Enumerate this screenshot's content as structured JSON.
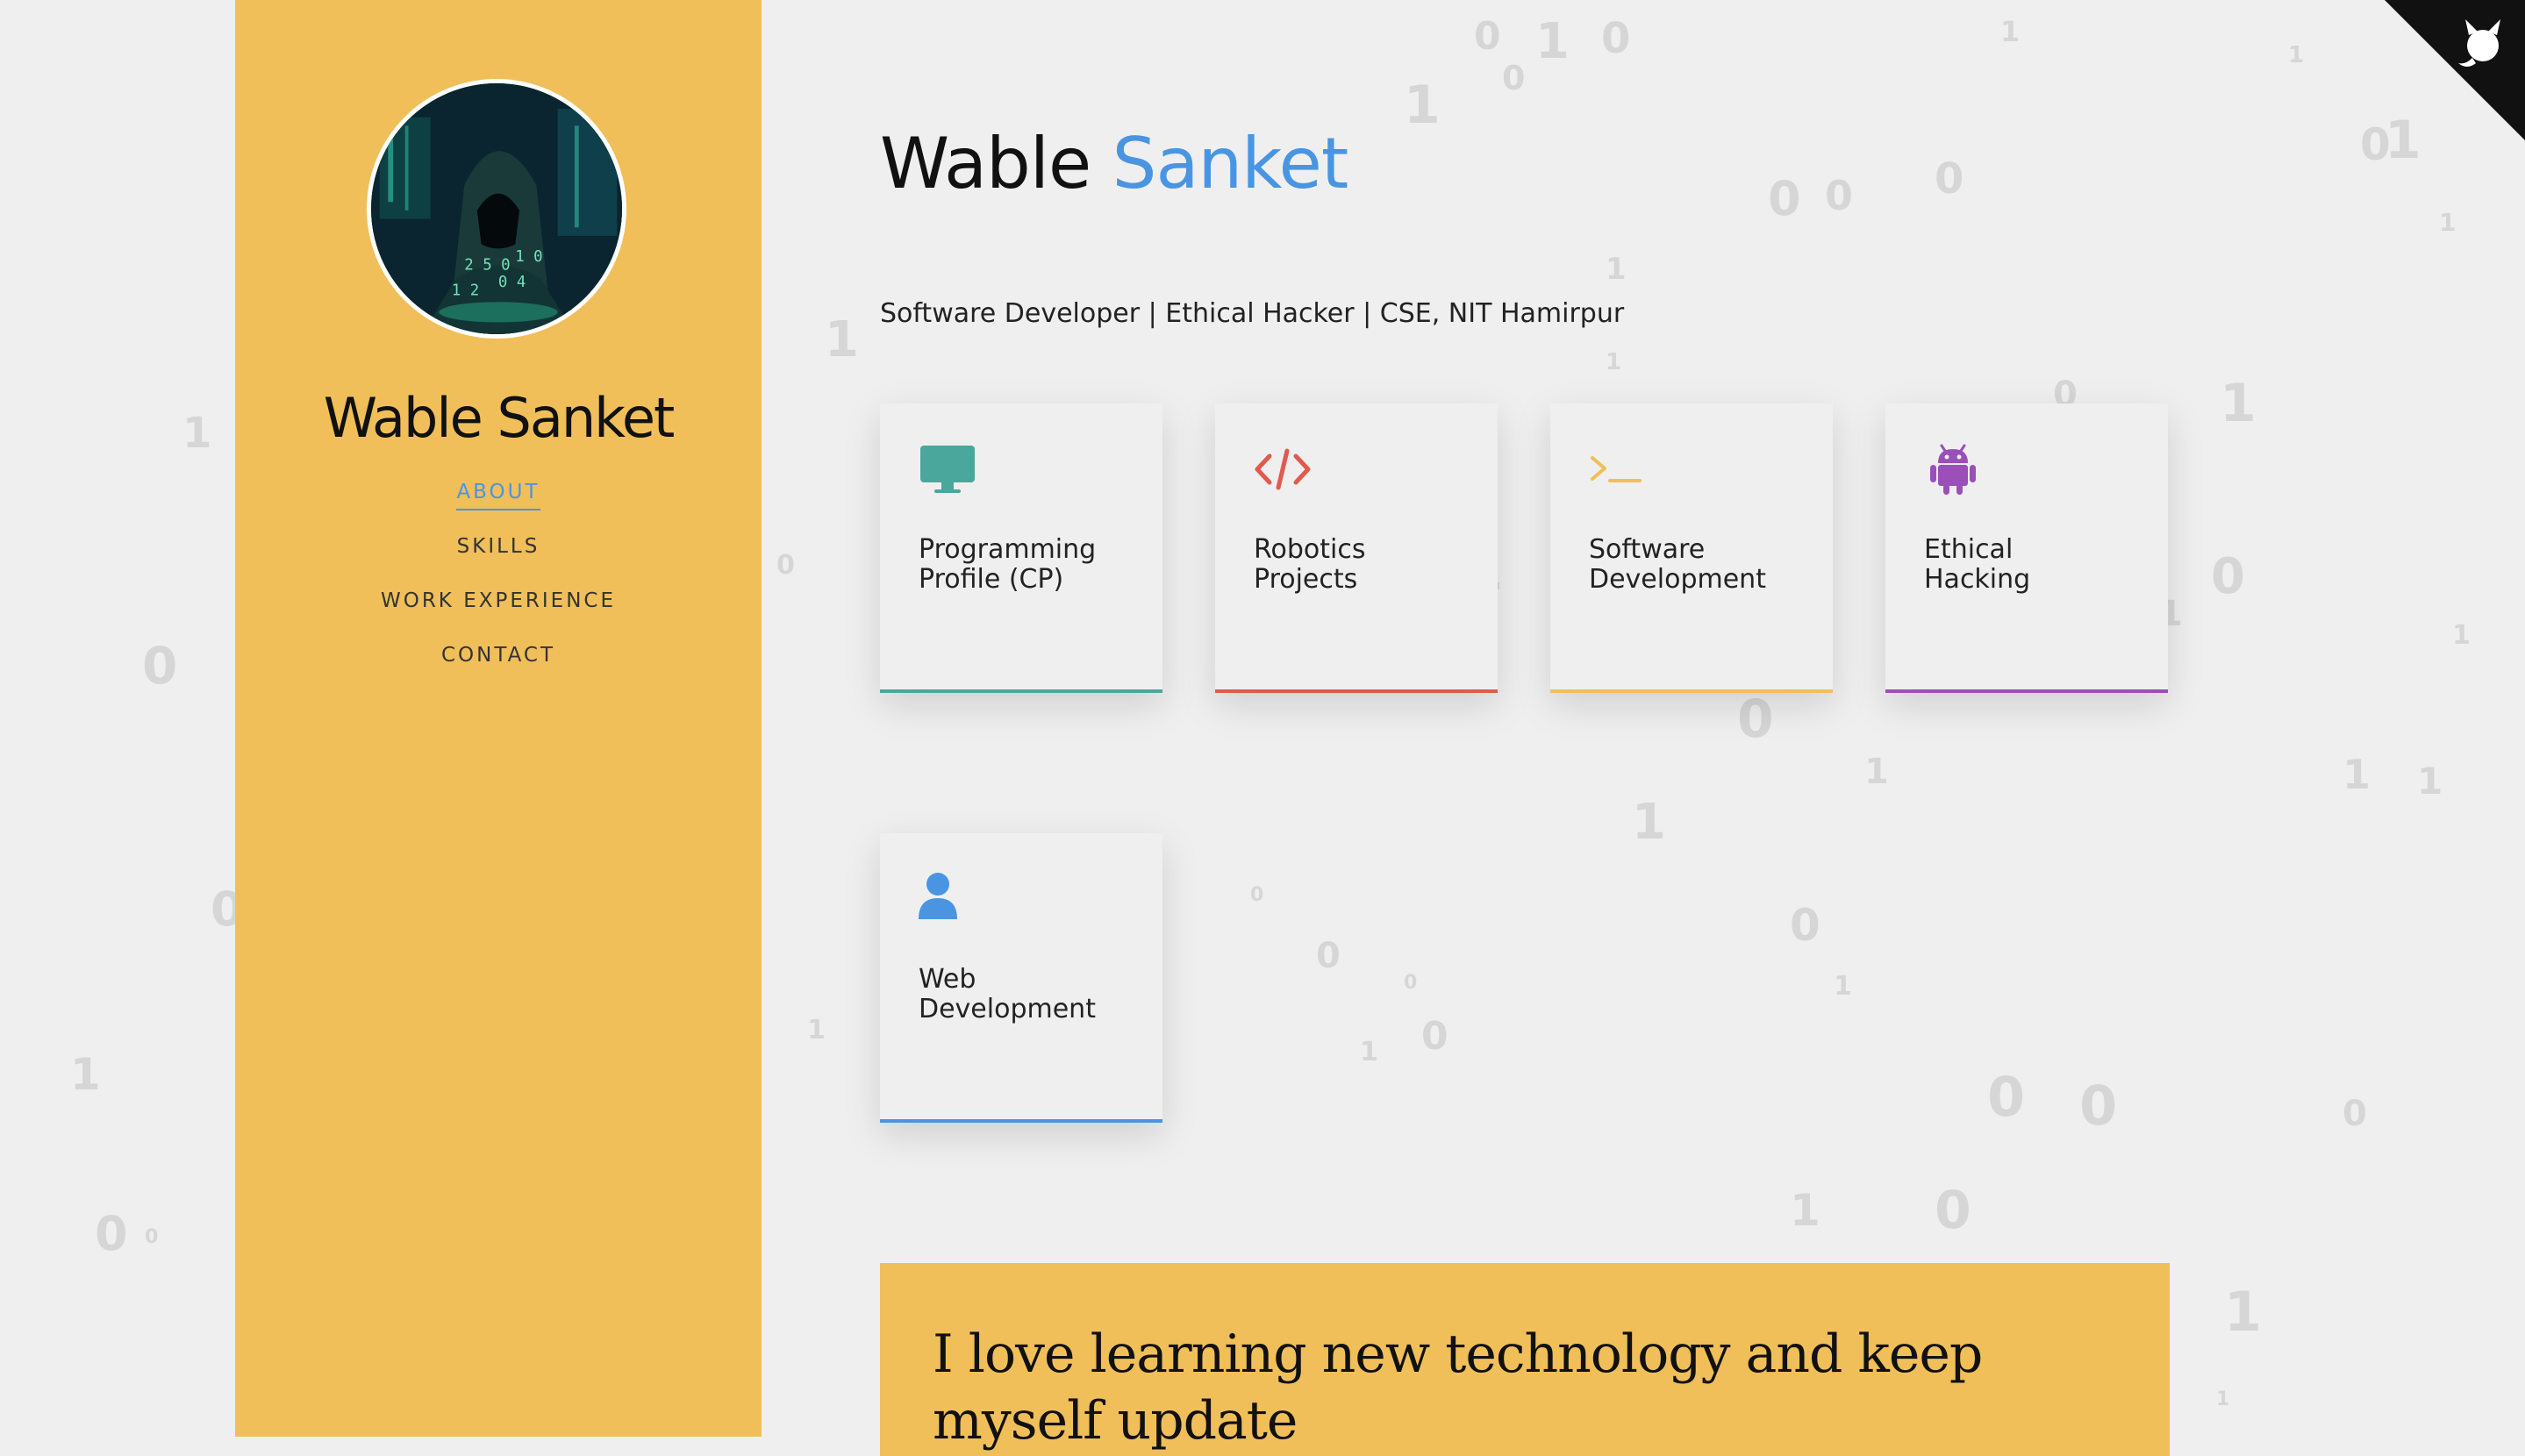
{
  "sidebar": {
    "name": "Wable Sanket",
    "nav": [
      {
        "label": "ABOUT",
        "active": true
      },
      {
        "label": "SKILLS",
        "active": false
      },
      {
        "label": "WORK EXPERIENCE",
        "active": false
      },
      {
        "label": "CONTACT",
        "active": false
      }
    ]
  },
  "header": {
    "first_name": "Wable",
    "last_name": "Sanket",
    "tagline": "Software Developer | Ethical Hacker | CSE, NIT Hamirpur"
  },
  "cards": [
    {
      "label": "Programming\nProfile (CP)",
      "icon": "monitor-icon",
      "color": "#4aa79c"
    },
    {
      "label": "Robotics\nProjects",
      "icon": "code-icon",
      "color": "#e05a4f"
    },
    {
      "label": "Software\nDevelopment",
      "icon": "terminal-icon",
      "color": "#f0bf5a"
    },
    {
      "label": "Ethical\nHacking",
      "icon": "android-icon",
      "color": "#9b4fb8"
    },
    {
      "label": "Web\nDevelopment",
      "icon": "user-icon",
      "color": "#4a95e2"
    }
  ],
  "quote": {
    "text": "I love learning new technology and keep myself update"
  },
  "colors": {
    "accent": "#4a95e2",
    "sidebar_bg": "#f0bf5a",
    "page_bg": "#efefef"
  },
  "github_corner": {
    "icon": "github-octocat-icon"
  }
}
